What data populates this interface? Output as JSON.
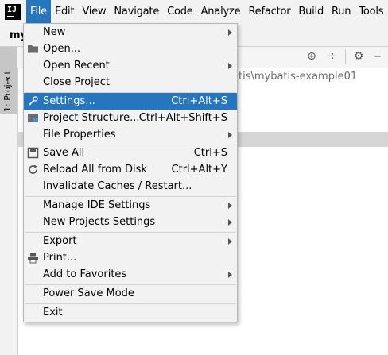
{
  "menubar": {
    "items": [
      "File",
      "Edit",
      "View",
      "Navigate",
      "Code",
      "Analyze",
      "Refactor",
      "Build",
      "Run",
      "Tools"
    ],
    "active_index": 0
  },
  "navbar": {
    "project_label": "my"
  },
  "sidebar": {
    "tab_label": "1: Project"
  },
  "editor": {
    "path_text": "tis\\mybatis-example01"
  },
  "file_menu": {
    "new": "New",
    "open": "Open...",
    "open_recent": "Open Recent",
    "close_project": "Close Project",
    "settings": "Settings...",
    "settings_shortcut": "Ctrl+Alt+S",
    "project_structure": "Project Structure...",
    "project_structure_shortcut": "Ctrl+Alt+Shift+S",
    "file_properties": "File Properties",
    "save_all": "Save All",
    "save_all_shortcut": "Ctrl+S",
    "reload": "Reload All from Disk",
    "reload_shortcut": "Ctrl+Alt+Y",
    "invalidate": "Invalidate Caches / Restart...",
    "manage_ide": "Manage IDE Settings",
    "new_projects_settings": "New Projects Settings",
    "export": "Export",
    "print": "Print...",
    "add_favorites": "Add to Favorites",
    "power_save": "Power Save Mode",
    "exit": "Exit"
  },
  "colors": {
    "accent": "#2675bf",
    "menu_bg": "#f2f2f2"
  }
}
